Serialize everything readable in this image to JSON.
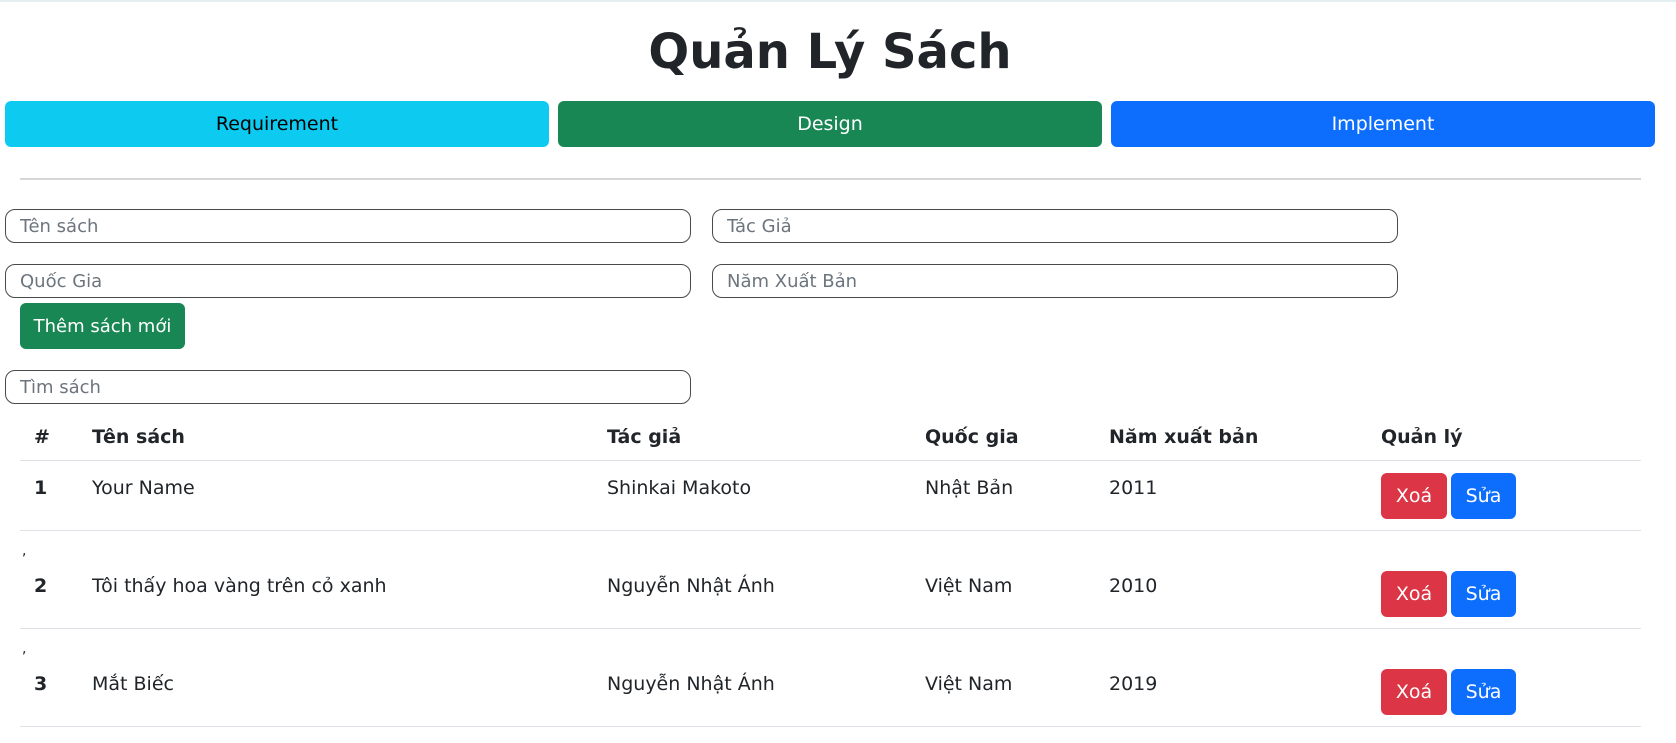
{
  "header": {
    "title": "Quản Lý Sách"
  },
  "phases": [
    {
      "label": "Requirement"
    },
    {
      "label": "Design"
    },
    {
      "label": "Implement"
    }
  ],
  "form": {
    "name_placeholder": "Tên sách",
    "author_placeholder": "Tác Giả",
    "country_placeholder": "Quốc Gia",
    "year_placeholder": "Năm Xuất Bản",
    "add_button": "Thêm sách mới",
    "search_placeholder": "Tìm sách"
  },
  "table": {
    "columns": [
      "#",
      "Tên sách",
      "Tác giả",
      "Quốc gia",
      "Năm xuất bản",
      "Quản lý"
    ],
    "separator": ",",
    "delete_label": "Xoá",
    "edit_label": "Sửa",
    "rows": [
      {
        "num": "1",
        "name": "Your Name",
        "author": "Shinkai Makoto",
        "country": "Nhật Bản",
        "year": "2011"
      },
      {
        "num": "2",
        "name": "Tôi thấy hoa vàng trên cỏ xanh",
        "author": "Nguyễn Nhật Ánh",
        "country": "Việt Nam",
        "year": "2010"
      },
      {
        "num": "3",
        "name": "Mắt Biếc",
        "author": "Nguyễn Nhật Ánh",
        "country": "Việt Nam",
        "year": "2019"
      }
    ]
  }
}
